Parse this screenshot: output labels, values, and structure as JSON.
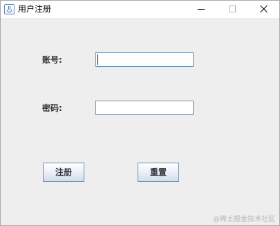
{
  "window": {
    "title": "用户注册",
    "app_icon": "java-cup-icon",
    "controls": {
      "minimize_icon": "minimize-icon",
      "maximize_icon": "maximize-icon",
      "close_icon": "close-icon"
    }
  },
  "form": {
    "account_label": "账号:",
    "account_value": "",
    "password_label": "密码:",
    "password_value": ""
  },
  "buttons": {
    "register_label": "注册",
    "reset_label": "重置"
  },
  "watermark": "@稀土掘金技术社区",
  "colors": {
    "window_background": "#eeeeee",
    "titlebar_background": "#ffffff",
    "field_border": "#7a8a99",
    "focused_field_border": "#6d8fb5",
    "button_gradient_top": "#ffffff",
    "button_gradient_bottom": "#cfdded"
  }
}
